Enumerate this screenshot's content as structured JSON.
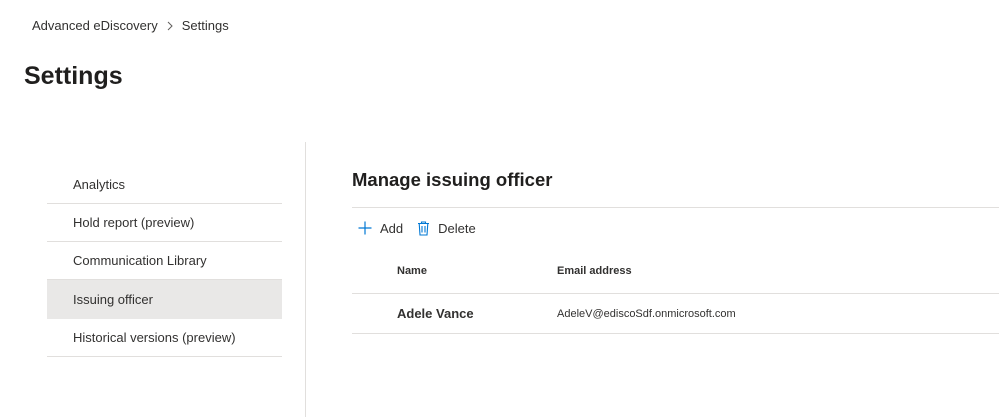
{
  "breadcrumb": {
    "root": "Advanced eDiscovery",
    "current": "Settings"
  },
  "page": {
    "title": "Settings"
  },
  "nav": {
    "items": [
      {
        "label": "Analytics"
      },
      {
        "label": "Hold report (preview)"
      },
      {
        "label": "Communication Library"
      },
      {
        "label": "Issuing officer",
        "selected": true
      },
      {
        "label": "Historical versions (preview)"
      }
    ]
  },
  "panel": {
    "title": "Manage issuing officer",
    "toolbar": {
      "add_label": "Add",
      "delete_label": "Delete",
      "add_icon": "plus-icon",
      "delete_icon": "trash-icon"
    },
    "table": {
      "columns": [
        "Name",
        "Email address"
      ],
      "rows": [
        {
          "name": "Adele Vance",
          "email": "AdeleV@ediscoSdf.onmicrosoft.com"
        }
      ]
    }
  },
  "colors": {
    "accent": "#0078d4",
    "selected_bg": "#e9e8e7",
    "divider": "#e1dfdd",
    "text": "#323130"
  }
}
